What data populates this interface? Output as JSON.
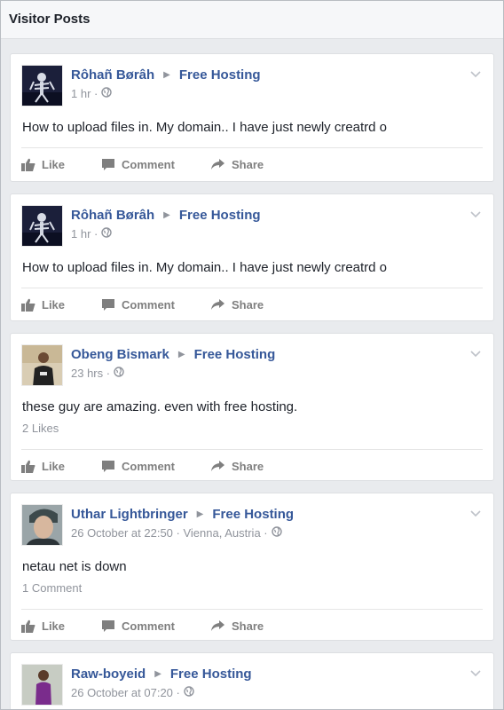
{
  "header": {
    "title": "Visitor Posts"
  },
  "actions": {
    "like": "Like",
    "comment": "Comment",
    "share": "Share"
  },
  "posts": [
    {
      "author": "Rôhañ Børâh",
      "target": "Free Hosting",
      "time": "1 hr",
      "text": "How to upload files in. My domain.. I have just newly creatrd o",
      "stats": "",
      "avatar": "skeleton-dark"
    },
    {
      "author": "Rôhañ Børâh",
      "target": "Free Hosting",
      "time": "1 hr",
      "text": "How to upload files in. My domain.. I have just newly creatrd o",
      "stats": "",
      "avatar": "skeleton-dark"
    },
    {
      "author": "Obeng Bismark",
      "target": "Free Hosting",
      "time": "23 hrs",
      "text": "these guy are amazing. even with free hosting.",
      "stats": "2 Likes",
      "avatar": "person-black-shirt"
    },
    {
      "author": "Uthar Lightbringer",
      "target": "Free Hosting",
      "time": "26 October at 22:50 · Vienna, Austria",
      "text": "netau net is down",
      "stats": "1 Comment",
      "avatar": "person-cap"
    },
    {
      "author": "Raw-boyeid",
      "target": "Free Hosting",
      "time": "26 October at 07:20",
      "text": "",
      "stats": "",
      "avatar": "person-purple"
    }
  ]
}
